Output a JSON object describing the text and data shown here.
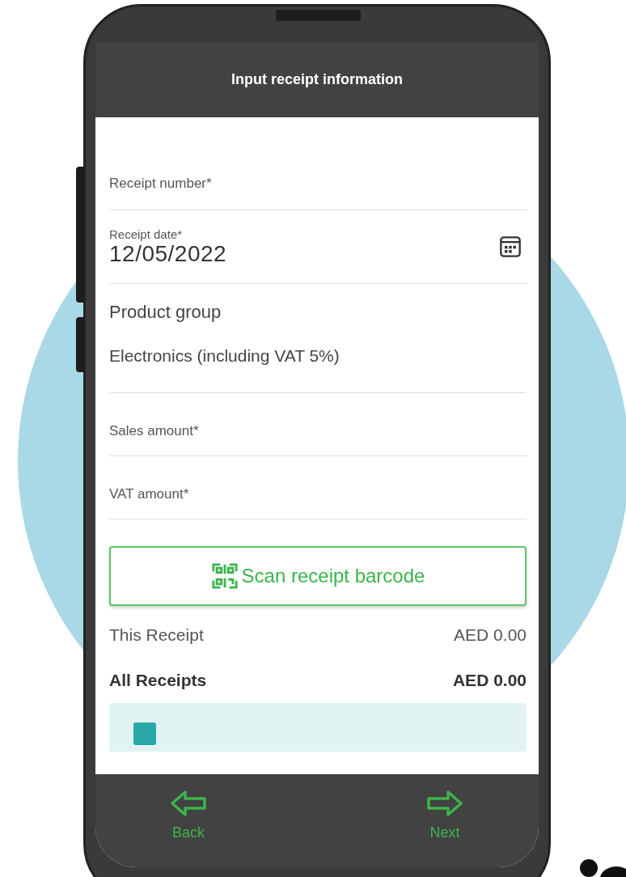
{
  "header": {
    "title": "Input receipt information"
  },
  "fields": [
    {
      "kind": "text",
      "label": "Receipt number*"
    },
    {
      "kind": "date",
      "label": "Receipt date*",
      "value": "12/05/2022"
    },
    {
      "kind": "select",
      "label": "Product group",
      "value": "Electronics (including VAT 5%)"
    },
    {
      "kind": "text",
      "label": "Sales amount*"
    },
    {
      "kind": "text",
      "label": "VAT amount*"
    }
  ],
  "scan_button": {
    "label": "Scan receipt barcode"
  },
  "totals": [
    {
      "label": "This Receipt",
      "amount": "AED 0.00",
      "bold": false
    },
    {
      "label": "All Receipts",
      "amount": "AED 0.00",
      "bold": true
    }
  ],
  "footer": [
    {
      "kind": "back",
      "label": "Back"
    },
    {
      "kind": "next",
      "label": "Next"
    }
  ]
}
